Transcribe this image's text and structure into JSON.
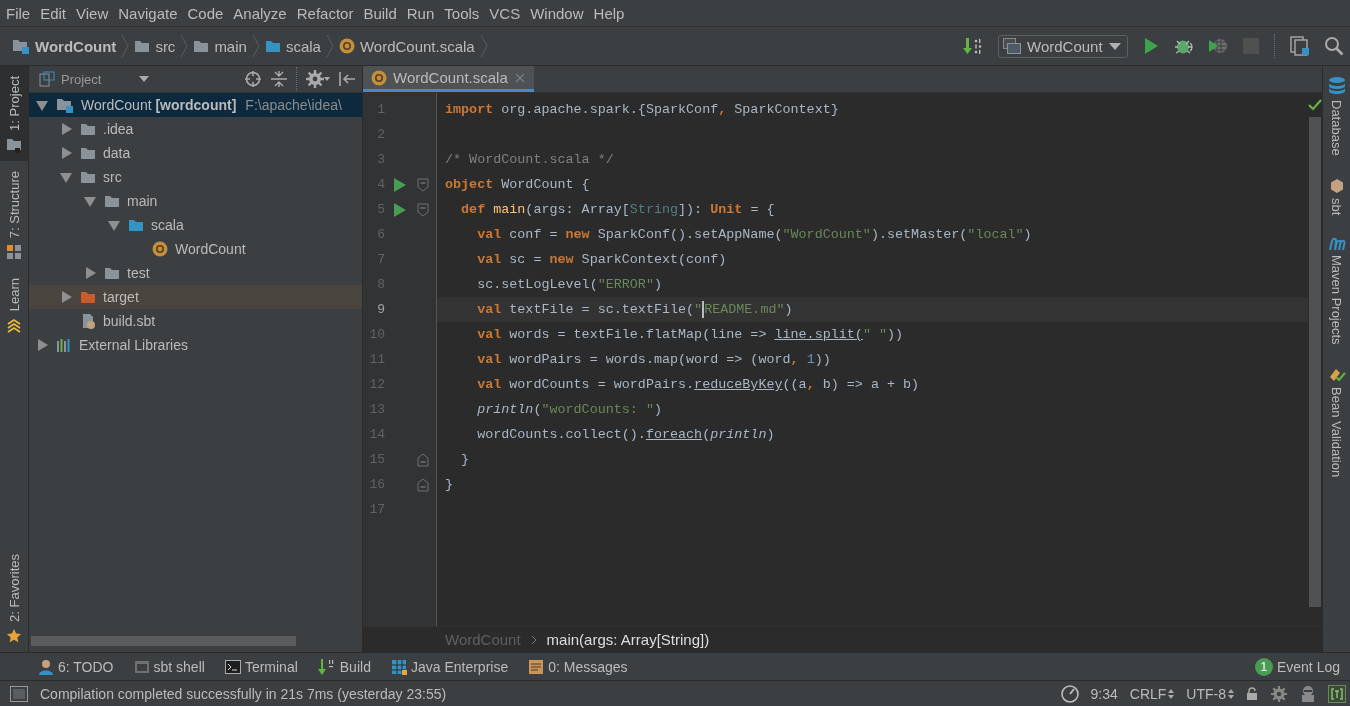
{
  "menu": [
    "File",
    "Edit",
    "View",
    "Navigate",
    "Code",
    "Analyze",
    "Refactor",
    "Build",
    "Run",
    "Tools",
    "VCS",
    "Window",
    "Help"
  ],
  "nav_bar": {
    "breadcrumbs": [
      {
        "label": "WordCount",
        "kind": "module"
      },
      {
        "label": "src",
        "kind": "folder"
      },
      {
        "label": "main",
        "kind": "folder"
      },
      {
        "label": "scala",
        "kind": "source"
      },
      {
        "label": "WordCount.scala",
        "kind": "class"
      }
    ],
    "run_config": "WordCount",
    "toolbar": [
      {
        "kind": "make",
        "disabled": false
      },
      {
        "kind": "run",
        "disabled": false
      },
      {
        "kind": "debug",
        "disabled": false
      },
      {
        "kind": "coverage",
        "disabled": false
      },
      {
        "kind": "stop",
        "disabled": true
      },
      {
        "kind": "structure",
        "disabled": false
      },
      {
        "kind": "search",
        "disabled": false
      }
    ]
  },
  "left_stripe": [
    {
      "label": "1: Project",
      "kind": "project",
      "selected": true
    },
    {
      "label": "7: Structure",
      "kind": "structure",
      "selected": false
    },
    {
      "label": "Learn",
      "kind": "learn",
      "selected": false
    },
    {
      "label": "2: Favorites",
      "kind": "favorites",
      "selected": false
    }
  ],
  "project_panel": {
    "title": "Project",
    "tree": [
      {
        "label": "WordCount",
        "tag": "[wordcount]",
        "path": "F:\\apache\\idea\\",
        "kind": "module",
        "expanded": true,
        "selected": true,
        "hovered": false,
        "children": [
          {
            "label": ".idea",
            "kind": "folder",
            "expanded": false,
            "selected": false,
            "hovered": false
          },
          {
            "label": "data",
            "kind": "folder",
            "expanded": false,
            "selected": false,
            "hovered": false
          },
          {
            "label": "src",
            "kind": "folder",
            "expanded": true,
            "selected": false,
            "hovered": false,
            "children": [
              {
                "label": "main",
                "kind": "folder",
                "expanded": true,
                "selected": false,
                "hovered": false,
                "children": [
                  {
                    "label": "scala",
                    "kind": "source",
                    "expanded": true,
                    "selected": false,
                    "hovered": false,
                    "children": [
                      {
                        "label": "WordCount",
                        "kind": "class",
                        "selected": false,
                        "hovered": false
                      }
                    ]
                  }
                ]
              },
              {
                "label": "test",
                "kind": "folder",
                "expanded": false,
                "selected": false,
                "hovered": false
              }
            ]
          },
          {
            "label": "target",
            "kind": "excluded",
            "expanded": false,
            "selected": false,
            "hovered": true
          },
          {
            "label": "build.sbt",
            "kind": "sbt",
            "selected": false,
            "hovered": false
          }
        ]
      },
      {
        "label": "External Libraries",
        "kind": "library",
        "expanded": false,
        "selected": false,
        "hovered": false
      }
    ]
  },
  "editor": {
    "tabs": [
      {
        "label": "WordCount.scala",
        "selected": true
      }
    ],
    "lines": [
      {
        "number": "1",
        "current": false,
        "run": false,
        "fold_open": false,
        "fold_close": false,
        "tokens": [
          {
            "kind": "keyword",
            "text": "import"
          },
          {
            "kind": "plain",
            "text": " org.apache.spark.{SparkConf"
          },
          {
            "kind": "keyword",
            "text": ","
          },
          {
            "kind": "plain",
            "text": " SparkContext}"
          }
        ]
      },
      {
        "number": "2",
        "current": false,
        "run": false,
        "fold_open": false,
        "fold_close": false
      },
      {
        "number": "3",
        "current": false,
        "run": false,
        "fold_open": false,
        "fold_close": false,
        "tokens": [
          {
            "kind": "comment",
            "text": "/* WordCount.scala */"
          }
        ]
      },
      {
        "number": "4",
        "current": false,
        "run": true,
        "fold_open": true,
        "fold_close": false,
        "tokens": [
          {
            "kind": "keyword",
            "text": "object"
          },
          {
            "kind": "plain",
            "text": " WordCount {"
          }
        ],
        "children": [
          {
            "number": "5",
            "current": false,
            "run": true,
            "fold_open": true,
            "fold_close": false,
            "tokens": [
              {
                "kind": "keyword",
                "text": "def"
              },
              {
                "kind": "declaration",
                "text": " main"
              },
              {
                "kind": "plain",
                "text": "(args: Array["
              },
              {
                "kind": "type",
                "text": "String"
              },
              {
                "kind": "plain",
                "text": "]): "
              },
              {
                "kind": "keyword",
                "text": "Unit"
              },
              {
                "kind": "plain",
                "text": " = {"
              }
            ],
            "children": [
              {
                "number": "6",
                "current": false,
                "run": false,
                "fold_open": false,
                "fold_close": false,
                "tokens": [
                  {
                    "kind": "keyword",
                    "text": "val"
                  },
                  {
                    "kind": "plain",
                    "text": " conf = "
                  },
                  {
                    "kind": "keyword",
                    "text": "new"
                  },
                  {
                    "kind": "plain",
                    "text": " SparkConf().setAppName("
                  },
                  {
                    "kind": "string",
                    "text": "\"WordCount\""
                  },
                  {
                    "kind": "plain",
                    "text": ").setMaster("
                  },
                  {
                    "kind": "string",
                    "text": "\"local\""
                  },
                  {
                    "kind": "plain",
                    "text": ")"
                  }
                ]
              },
              {
                "number": "7",
                "current": false,
                "run": false,
                "fold_open": false,
                "fold_close": false,
                "tokens": [
                  {
                    "kind": "keyword",
                    "text": "val"
                  },
                  {
                    "kind": "plain",
                    "text": " sc = "
                  },
                  {
                    "kind": "keyword",
                    "text": "new"
                  },
                  {
                    "kind": "plain",
                    "text": " SparkContext(conf)"
                  }
                ]
              },
              {
                "number": "8",
                "current": false,
                "run": false,
                "fold_open": false,
                "fold_close": false,
                "tokens": [
                  {
                    "kind": "plain",
                    "text": "sc.setLogLevel("
                  },
                  {
                    "kind": "string",
                    "text": "\"ERROR\""
                  },
                  {
                    "kind": "plain",
                    "text": ")"
                  }
                ]
              },
              {
                "number": "9",
                "current": true,
                "run": false,
                "fold_open": false,
                "fold_close": false,
                "tokens": [
                  {
                    "kind": "keyword",
                    "text": "val"
                  },
                  {
                    "kind": "plain",
                    "text": " textFile = sc.textFile("
                  },
                  {
                    "kind": "string",
                    "text": "\""
                  },
                  {
                    "kind": "caret"
                  },
                  {
                    "kind": "string",
                    "text": "README.md\""
                  },
                  {
                    "kind": "plain",
                    "text": ")"
                  }
                ]
              },
              {
                "number": "10",
                "current": false,
                "run": false,
                "fold_open": false,
                "fold_close": false,
                "tokens": [
                  {
                    "kind": "keyword",
                    "text": "val"
                  },
                  {
                    "kind": "plain",
                    "text": " words = textFile.flatMap(line => "
                  },
                  {
                    "kind": "underline",
                    "text": "line.split("
                  },
                  {
                    "kind": "string",
                    "text": "\" \""
                  },
                  {
                    "kind": "plain",
                    "text": "))"
                  }
                ]
              },
              {
                "number": "11",
                "current": false,
                "run": false,
                "fold_open": false,
                "fold_close": false,
                "tokens": [
                  {
                    "kind": "keyword",
                    "text": "val"
                  },
                  {
                    "kind": "plain",
                    "text": " wordPairs = words.map(word => (word"
                  },
                  {
                    "kind": "keyword",
                    "text": ","
                  },
                  {
                    "kind": "number",
                    "text": " 1"
                  },
                  {
                    "kind": "plain",
                    "text": "))"
                  }
                ]
              },
              {
                "number": "12",
                "current": false,
                "run": false,
                "fold_open": false,
                "fold_close": false,
                "tokens": [
                  {
                    "kind": "keyword",
                    "text": "val"
                  },
                  {
                    "kind": "plain",
                    "text": " wordCounts = wordPairs."
                  },
                  {
                    "kind": "underline",
                    "text": "reduceByKey"
                  },
                  {
                    "kind": "plain",
                    "text": "((a"
                  },
                  {
                    "kind": "keyword",
                    "text": ","
                  },
                  {
                    "kind": "plain",
                    "text": " b) => a + b)"
                  }
                ]
              },
              {
                "number": "13",
                "current": false,
                "run": false,
                "fold_open": false,
                "fold_close": false,
                "tokens": [
                  {
                    "kind": "italic",
                    "text": "println"
                  },
                  {
                    "kind": "plain",
                    "text": "("
                  },
                  {
                    "kind": "string",
                    "text": "\"wordCounts: \""
                  },
                  {
                    "kind": "plain",
                    "text": ")"
                  }
                ]
              },
              {
                "number": "14",
                "current": false,
                "run": false,
                "fold_open": false,
                "fold_close": false,
                "tokens": [
                  {
                    "kind": "plain",
                    "text": "wordCounts.collect()."
                  },
                  {
                    "kind": "underline",
                    "text": "foreach"
                  },
                  {
                    "kind": "plain",
                    "text": "("
                  },
                  {
                    "kind": "italic",
                    "text": "println"
                  },
                  {
                    "kind": "plain",
                    "text": ")"
                  }
                ]
              }
            ]
          },
          {
            "number": "15",
            "current": false,
            "run": false,
            "fold_open": false,
            "fold_close": true,
            "tokens": [
              {
                "kind": "plain",
                "text": "}"
              }
            ]
          }
        ]
      },
      {
        "number": "16",
        "current": false,
        "run": false,
        "fold_open": false,
        "fold_close": true,
        "tokens": [
          {
            "kind": "plain",
            "text": "}"
          }
        ]
      },
      {
        "number": "17",
        "current": false,
        "run": false,
        "fold_open": false,
        "fold_close": false
      }
    ],
    "breadcrumbs": [
      "WordCount",
      "main(args: Array[String])"
    ]
  },
  "right_stripe": [
    {
      "label": "Database",
      "kind": "database"
    },
    {
      "label": "sbt",
      "kind": "sbt"
    },
    {
      "label": "Maven Projects",
      "kind": "maven"
    },
    {
      "label": "Bean Validation",
      "kind": "bean"
    }
  ],
  "tool_windows": [
    {
      "label": "6: TODO",
      "kind": "todo"
    },
    {
      "label": "sbt shell",
      "kind": "sbt"
    },
    {
      "label": "Terminal",
      "kind": "terminal"
    },
    {
      "label": "Build",
      "kind": "build"
    },
    {
      "label": "Java Enterprise",
      "kind": "javaee"
    },
    {
      "label": "0: Messages",
      "kind": "messages"
    }
  ],
  "event_log": {
    "label": "Event Log",
    "count": "1"
  },
  "status_bar": {
    "message": "Compilation completed successfully in 21s 7ms (yesterday 23:55)",
    "position": "9:34",
    "line_separator": "CRLF",
    "encoding": "UTF-8"
  }
}
